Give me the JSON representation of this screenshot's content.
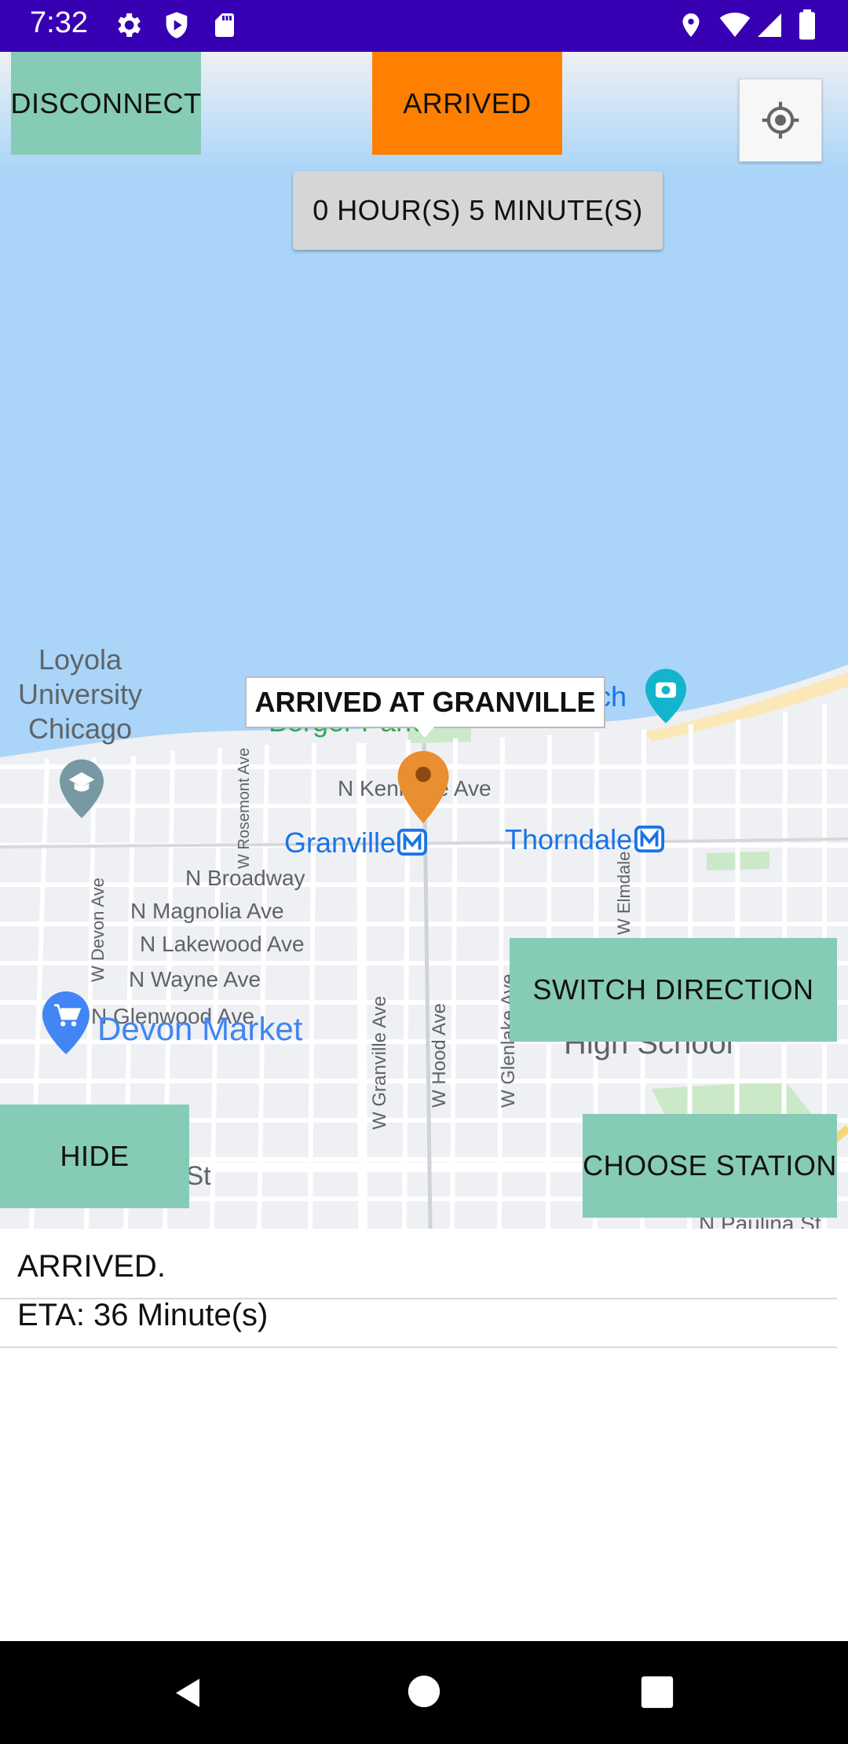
{
  "status_bar": {
    "time": "7:32",
    "left_icons": [
      "gear-icon",
      "shield-play-icon",
      "sd-card-icon"
    ],
    "right_icons": [
      "location-icon",
      "wifi-icon",
      "cellular-icon",
      "battery-icon"
    ]
  },
  "map": {
    "buttons": {
      "disconnect": "DISCONNECT",
      "arrived": "ARRIVED",
      "timer": "0 HOUR(S) 5 MINUTE(S)",
      "switch_direction": "SWITCH DIRECTION",
      "hide": "HIDE",
      "choose_station": "CHOOSE STATION"
    },
    "marker_callout": "ARRIVED AT GRANVILLE",
    "labels": {
      "loyola_line1": "Loyola",
      "loyola_line2": "University",
      "loyola_line3": "Chicago",
      "beach_partial": "ach",
      "berger_partial": "Berger Park",
      "n_kenmore": "N Kenmore Ave",
      "granville_station": "Granville",
      "thorndale_station": "Thorndale",
      "w_rosemont": "W Rosemont Ave",
      "n_broadway": "N Broadway",
      "n_magnolia": "N Magnolia Ave",
      "n_lakewood": "N Lakewood Ave",
      "n_wayne": "N Wayne Ave",
      "n_glenwood": "N Glenwood Ave",
      "w_devon": "W Devon Ave",
      "devon_market": "Devon Market",
      "w_granville": "W Granville Ave",
      "w_hood": "W Hood Ave",
      "w_glenlake": "W Glenlake Ave",
      "w_elmdale": "W Elmdale",
      "high_school": "High School",
      "k_st": "k St",
      "paulina": "N Paulina St"
    },
    "colors": {
      "water": "#aad5f9",
      "land": "#eef0f3",
      "marker": "#e98f31",
      "transit": "#1a73e8",
      "accent_button": "#86cbb6",
      "arrived_button": "#ff8000"
    }
  },
  "info": {
    "status": "ARRIVED.",
    "eta": "ETA: 36 Minute(s)"
  },
  "nav_bar": {
    "icons": [
      "back-icon",
      "home-icon",
      "recents-icon"
    ]
  }
}
